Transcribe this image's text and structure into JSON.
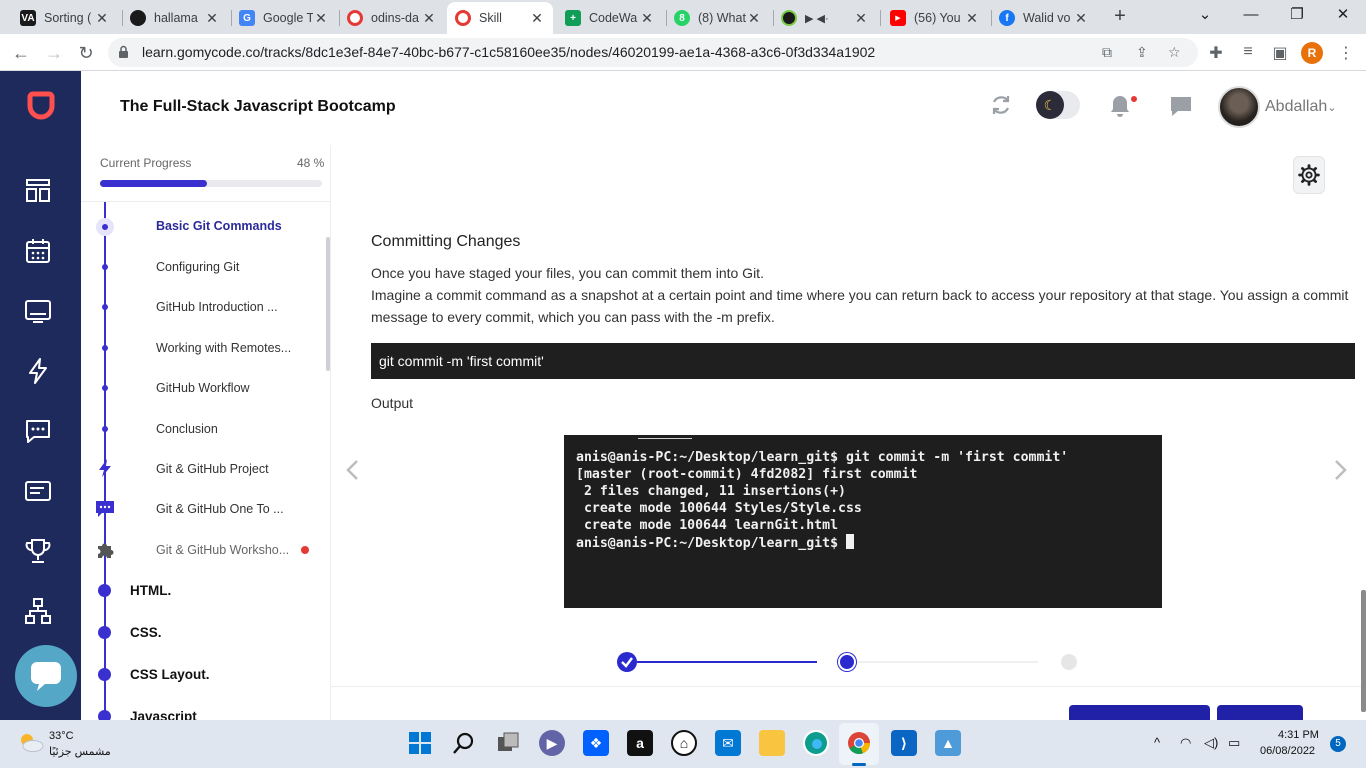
{
  "browser": {
    "tabs": [
      {
        "title": "Sorting (",
        "favicon": "VA",
        "color": "#1a1a1a"
      },
      {
        "title": "hallama",
        "favicon": "gh",
        "color": "#1a1a1a"
      },
      {
        "title": "Google T",
        "favicon": "G",
        "color": "#4285f4"
      },
      {
        "title": "odins-da",
        "favicon": "o",
        "color": "#e53935"
      },
      {
        "title": "Skill",
        "favicon": "S",
        "color": "#e53935"
      },
      {
        "title": "CodeWa",
        "favicon": "+",
        "color": "#0f9d58"
      },
      {
        "title": "(8) What",
        "favicon": "8",
        "color": "#25d366"
      },
      {
        "title": "",
        "favicon": "●",
        "color": "#1a1a1a"
      },
      {
        "title": "(56) You",
        "favicon": "▶",
        "color": "#ff0000"
      },
      {
        "title": "Walid vo",
        "favicon": "f",
        "color": "#1877f2"
      }
    ],
    "tab_extra_audio": "▶ ◀·",
    "url": "learn.gomycode.co/tracks/8dc1e3ef-84e7-40bc-b677-c1c58160ee35/nodes/46020199-ae1a-4368-a3c6-0f3d334a1902",
    "profile_initial": "R"
  },
  "header": {
    "course_title": "The Full-Stack Javascript Bootcamp",
    "user_name": "Abdallah"
  },
  "sidebar": {
    "progress_label": "Current Progress",
    "progress_text": "48 %",
    "progress_value": 0.48,
    "lessons": [
      {
        "label": "Basic Git Commands",
        "active": true
      },
      {
        "label": "Configuring Git"
      },
      {
        "label": "GitHub Introduction ..."
      },
      {
        "label": "Working with Remotes..."
      },
      {
        "label": "GitHub Workflow"
      },
      {
        "label": "Conclusion"
      },
      {
        "label": "Git & GitHub Project",
        "icon": "lightning-icon"
      },
      {
        "label": "Git & GitHub One To ...",
        "icon": "chat-icon"
      },
      {
        "label": "Git & GitHub Worksho...",
        "icon": "puzzle-icon"
      }
    ],
    "modules": [
      "HTML.",
      "CSS.",
      "CSS Layout.",
      "Javascript"
    ]
  },
  "lesson": {
    "title": "Committing Changes",
    "paragraph_1": "Once you have staged your files, you can commit them into Git.",
    "paragraph_2": "Imagine a commit command as a snapshot at a certain point and time where you can return back to access your repository at that stage. You assign a commit message to every commit, which you can pass with the -m prefix.",
    "code": "git commit -m 'first commit'",
    "output_label": "Output",
    "terminal_lines": [
      "anis@anis-PC:~/Desktop/learn_git$ git commit -m 'first commit'",
      "[master (root-commit) 4fd2082] first commit",
      " 2 files changed, 11 insertions(+)",
      " create mode 100644 Styles/Style.css",
      " create mode 100644 learnGit.html",
      "anis@anis-PC:~/Desktop/learn_git$ "
    ]
  },
  "taskbar": {
    "temperature": "33°C",
    "weather": "مشمس جزئيًا",
    "time": "4:31 PM",
    "date": "06/08/2022",
    "notifications": "5"
  },
  "colors": {
    "rail": "#1f2a5c",
    "accent": "#3a2fcf",
    "logo": "#ff4f4f"
  }
}
